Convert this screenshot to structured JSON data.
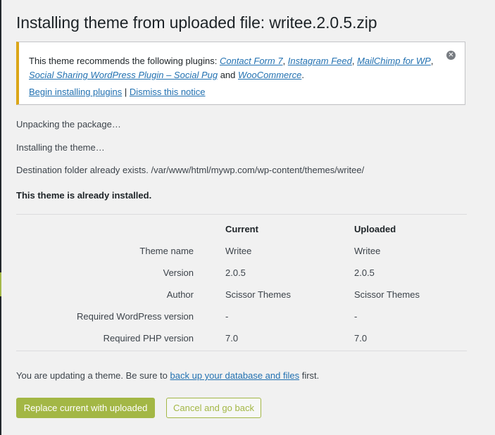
{
  "page": {
    "title": "Installing theme from uploaded file: writee.2.0.5.zip"
  },
  "notice": {
    "intro": "This theme recommends the following plugins: ",
    "plugins": [
      "Contact Form 7",
      "Instagram Feed",
      "MailChimp for WP",
      "Social Sharing WordPress Plugin – Social Pug",
      "WooCommerce"
    ],
    "sep": ", ",
    "and": " and ",
    "end": ".",
    "begin_link": "Begin installing plugins",
    "divider": " | ",
    "dismiss_link": "Dismiss this notice",
    "close_glyph": "✕"
  },
  "log": {
    "unpacking": "Unpacking the package…",
    "installing": "Installing the theme…",
    "destination": "Destination folder already exists. /var/www/html/mywp.com/wp-content/themes/writee/",
    "already": "This theme is already installed."
  },
  "compare": {
    "headers": {
      "current": "Current",
      "uploaded": "Uploaded"
    },
    "rows": [
      {
        "label": "Theme name",
        "current": "Writee",
        "uploaded": "Writee"
      },
      {
        "label": "Version",
        "current": "2.0.5",
        "uploaded": "2.0.5"
      },
      {
        "label": "Author",
        "current": "Scissor Themes",
        "uploaded": "Scissor Themes"
      },
      {
        "label": "Required WordPress version",
        "current": "-",
        "uploaded": "-"
      },
      {
        "label": "Required PHP version",
        "current": "7.0",
        "uploaded": "7.0"
      }
    ]
  },
  "footer": {
    "note_before": "You are updating a theme. Be sure to ",
    "note_link": "back up your database and files",
    "note_after": " first.",
    "replace_button": "Replace current with uploaded",
    "cancel_button": "Cancel and go back"
  },
  "colors": {
    "accent": "#a3b745",
    "link": "#2271b1",
    "notice_warning": "#dba617"
  }
}
